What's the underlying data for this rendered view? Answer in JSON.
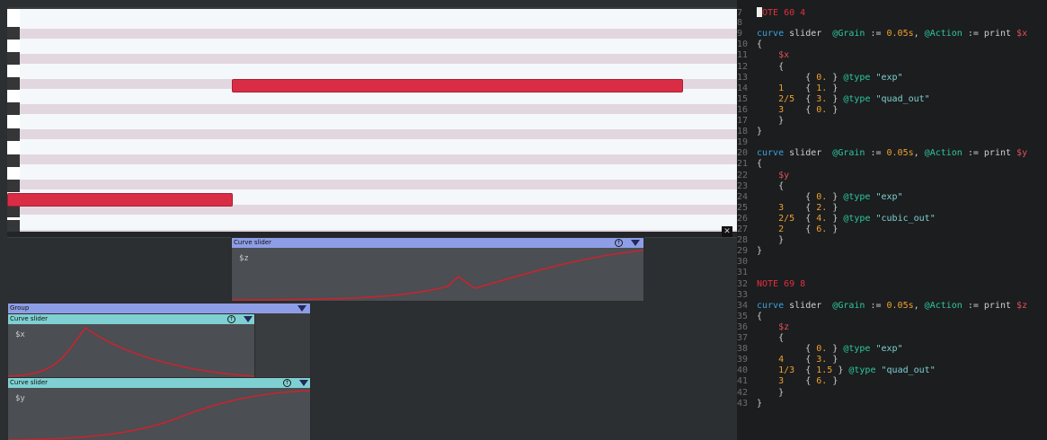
{
  "panels": {
    "curve_z": {
      "title": "Curve slider",
      "var": "$z"
    },
    "group": {
      "title": "Group"
    },
    "curve_x": {
      "title": "Curve slider",
      "var": "$x"
    },
    "curve_y": {
      "title": "Curve slider",
      "var": "$y"
    }
  },
  "editor": {
    "lines": [
      {
        "n": "7",
        "t": "NOTE 60 4"
      },
      {
        "n": "8",
        "t": ""
      },
      {
        "n": "9",
        "t": "curve slider  @Grain := 0.05s, @Action := print $x"
      },
      {
        "n": "10",
        "t": "{"
      },
      {
        "n": "11",
        "t": "    $x"
      },
      {
        "n": "12",
        "t": "    {"
      },
      {
        "n": "13",
        "t": "         { 0. } @type \"exp\""
      },
      {
        "n": "14",
        "t": "    1    { 1. }"
      },
      {
        "n": "15",
        "t": "    2/5  { 3. } @type \"quad_out\""
      },
      {
        "n": "16",
        "t": "    3    { 0. }"
      },
      {
        "n": "17",
        "t": "    }"
      },
      {
        "n": "18",
        "t": "}"
      },
      {
        "n": "19",
        "t": ""
      },
      {
        "n": "20",
        "t": "curve slider  @Grain := 0.05s, @Action := print $y"
      },
      {
        "n": "21",
        "t": "{"
      },
      {
        "n": "22",
        "t": "    $y"
      },
      {
        "n": "23",
        "t": "    {"
      },
      {
        "n": "24",
        "t": "         { 0. } @type \"exp\""
      },
      {
        "n": "25",
        "t": "    3    { 2. }"
      },
      {
        "n": "26",
        "t": "    2/5  { 4. } @type \"cubic_out\""
      },
      {
        "n": "27",
        "t": "    2    { 6. }"
      },
      {
        "n": "28",
        "t": "    }"
      },
      {
        "n": "29",
        "t": "}"
      },
      {
        "n": "30",
        "t": ""
      },
      {
        "n": "31",
        "t": ""
      },
      {
        "n": "32",
        "t": "NOTE 69 8"
      },
      {
        "n": "33",
        "t": ""
      },
      {
        "n": "34",
        "t": "curve slider  @Grain := 0.05s, @Action := print $z"
      },
      {
        "n": "35",
        "t": "{"
      },
      {
        "n": "36",
        "t": "    $z"
      },
      {
        "n": "37",
        "t": "    {"
      },
      {
        "n": "38",
        "t": "         { 0. } @type \"exp\""
      },
      {
        "n": "39",
        "t": "    4    { 3. }"
      },
      {
        "n": "40",
        "t": "    1/3  { 1.5 } @type \"quad_out\""
      },
      {
        "n": "41",
        "t": "    3    { 6. }"
      },
      {
        "n": "42",
        "t": "    }"
      },
      {
        "n": "43",
        "t": "}"
      }
    ]
  },
  "colors": {
    "note": "#d92d45",
    "header_blue": "#8e9ee6",
    "header_cyan": "#7fd0d2",
    "curve": "#c8242f"
  },
  "icons": [
    "collapse-triangle-icon",
    "expand-circle-icon",
    "close-icon"
  ]
}
